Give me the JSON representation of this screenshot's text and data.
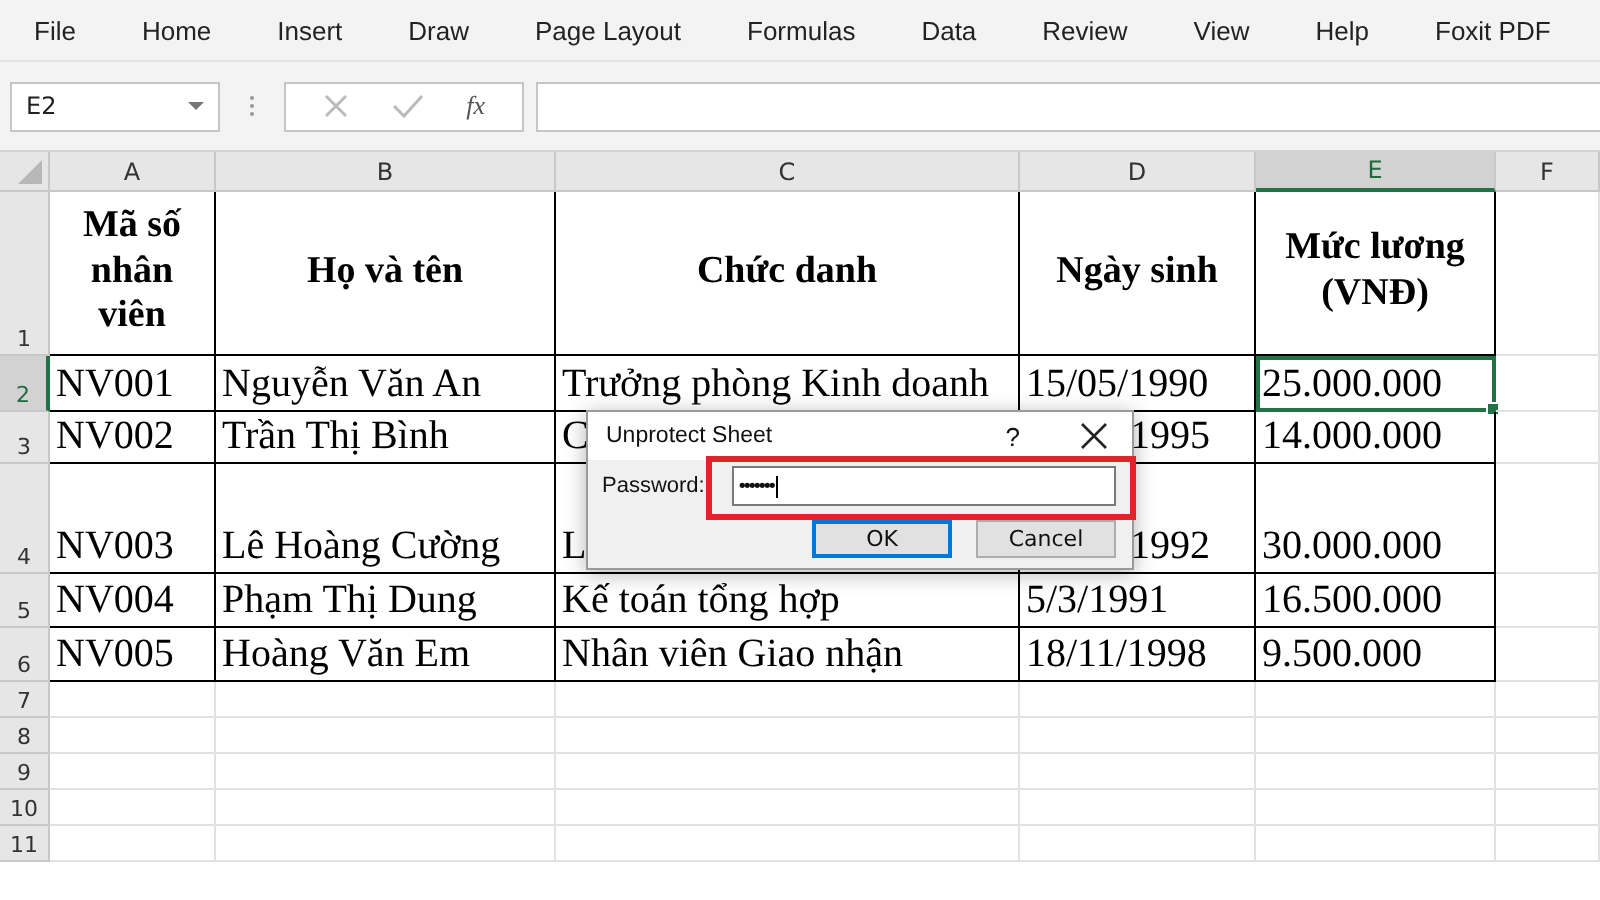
{
  "menu": [
    "File",
    "Home",
    "Insert",
    "Draw",
    "Page Layout",
    "Formulas",
    "Data",
    "Review",
    "View",
    "Help",
    "Foxit PDF"
  ],
  "name_box": {
    "value": "E2"
  },
  "formula_bar": {
    "function_label": "fx"
  },
  "columns": [
    {
      "label": "A",
      "selected": false
    },
    {
      "label": "B",
      "selected": false
    },
    {
      "label": "C",
      "selected": false
    },
    {
      "label": "D",
      "selected": false
    },
    {
      "label": "E",
      "selected": true
    },
    {
      "label": "F",
      "selected": false
    }
  ],
  "rows": [
    {
      "number": "1",
      "selected": false,
      "cells": [
        {
          "text": "Mã số nhân viên",
          "selected": false
        },
        {
          "text": "Họ và tên",
          "selected": false
        },
        {
          "text": "Chức danh",
          "selected": false
        },
        {
          "text": "Ngày sinh",
          "selected": false
        },
        {
          "text": "Mức lương (VNĐ)",
          "selected": false
        }
      ]
    },
    {
      "number": "2",
      "selected": true,
      "cells": [
        {
          "text": "NV001",
          "selected": false
        },
        {
          "text": "Nguyễn Văn An",
          "selected": false
        },
        {
          "text": "Trưởng phòng Kinh doanh",
          "selected": false
        },
        {
          "text": "15/05/1990",
          "selected": false
        },
        {
          "text": "25.000.000",
          "selected": true
        }
      ]
    },
    {
      "number": "3",
      "selected": false,
      "cells": [
        {
          "text": "NV002",
          "selected": false
        },
        {
          "text": "Trần Thị Bình",
          "selected": false
        },
        {
          "text": "C",
          "selected": false
        },
        {
          "text": "1995",
          "selected": false,
          "partly_covered": true
        },
        {
          "text": "14.000.000",
          "selected": false
        }
      ]
    },
    {
      "number": "4",
      "selected": false,
      "cells": [
        {
          "text": "NV003",
          "selected": false
        },
        {
          "text": "Lê Hoàng Cường",
          "selected": false
        },
        {
          "text": "L",
          "selected": false
        },
        {
          "text": "1992",
          "selected": false,
          "partly_covered": true
        },
        {
          "text": "30.000.000",
          "selected": false
        }
      ]
    },
    {
      "number": "5",
      "selected": false,
      "cells": [
        {
          "text": "NV004",
          "selected": false
        },
        {
          "text": "Phạm Thị Dung",
          "selected": false
        },
        {
          "text": "Kế toán tổng hợp",
          "selected": false
        },
        {
          "text": "5/3/1991",
          "selected": false
        },
        {
          "text": "16.500.000",
          "selected": false
        }
      ]
    },
    {
      "number": "6",
      "selected": false,
      "cells": [
        {
          "text": "NV005",
          "selected": false
        },
        {
          "text": "Hoàng Văn Em",
          "selected": false
        },
        {
          "text": "Nhân viên Giao nhận",
          "selected": false
        },
        {
          "text": "18/11/1998",
          "selected": false
        },
        {
          "text": "9.500.000",
          "selected": false
        }
      ]
    },
    {
      "number": "7",
      "selected": false
    },
    {
      "number": "8",
      "selected": false
    },
    {
      "number": "9",
      "selected": false
    },
    {
      "number": "10",
      "selected": false
    },
    {
      "number": "11",
      "selected": false
    }
  ],
  "dialog": {
    "title": "Unprotect Sheet",
    "help": "?",
    "password_label": "Password:",
    "password_value": "•••••••",
    "focused": true,
    "buttons": [
      {
        "label": "OK",
        "default": true
      },
      {
        "label": "Cancel",
        "default": false
      }
    ]
  }
}
